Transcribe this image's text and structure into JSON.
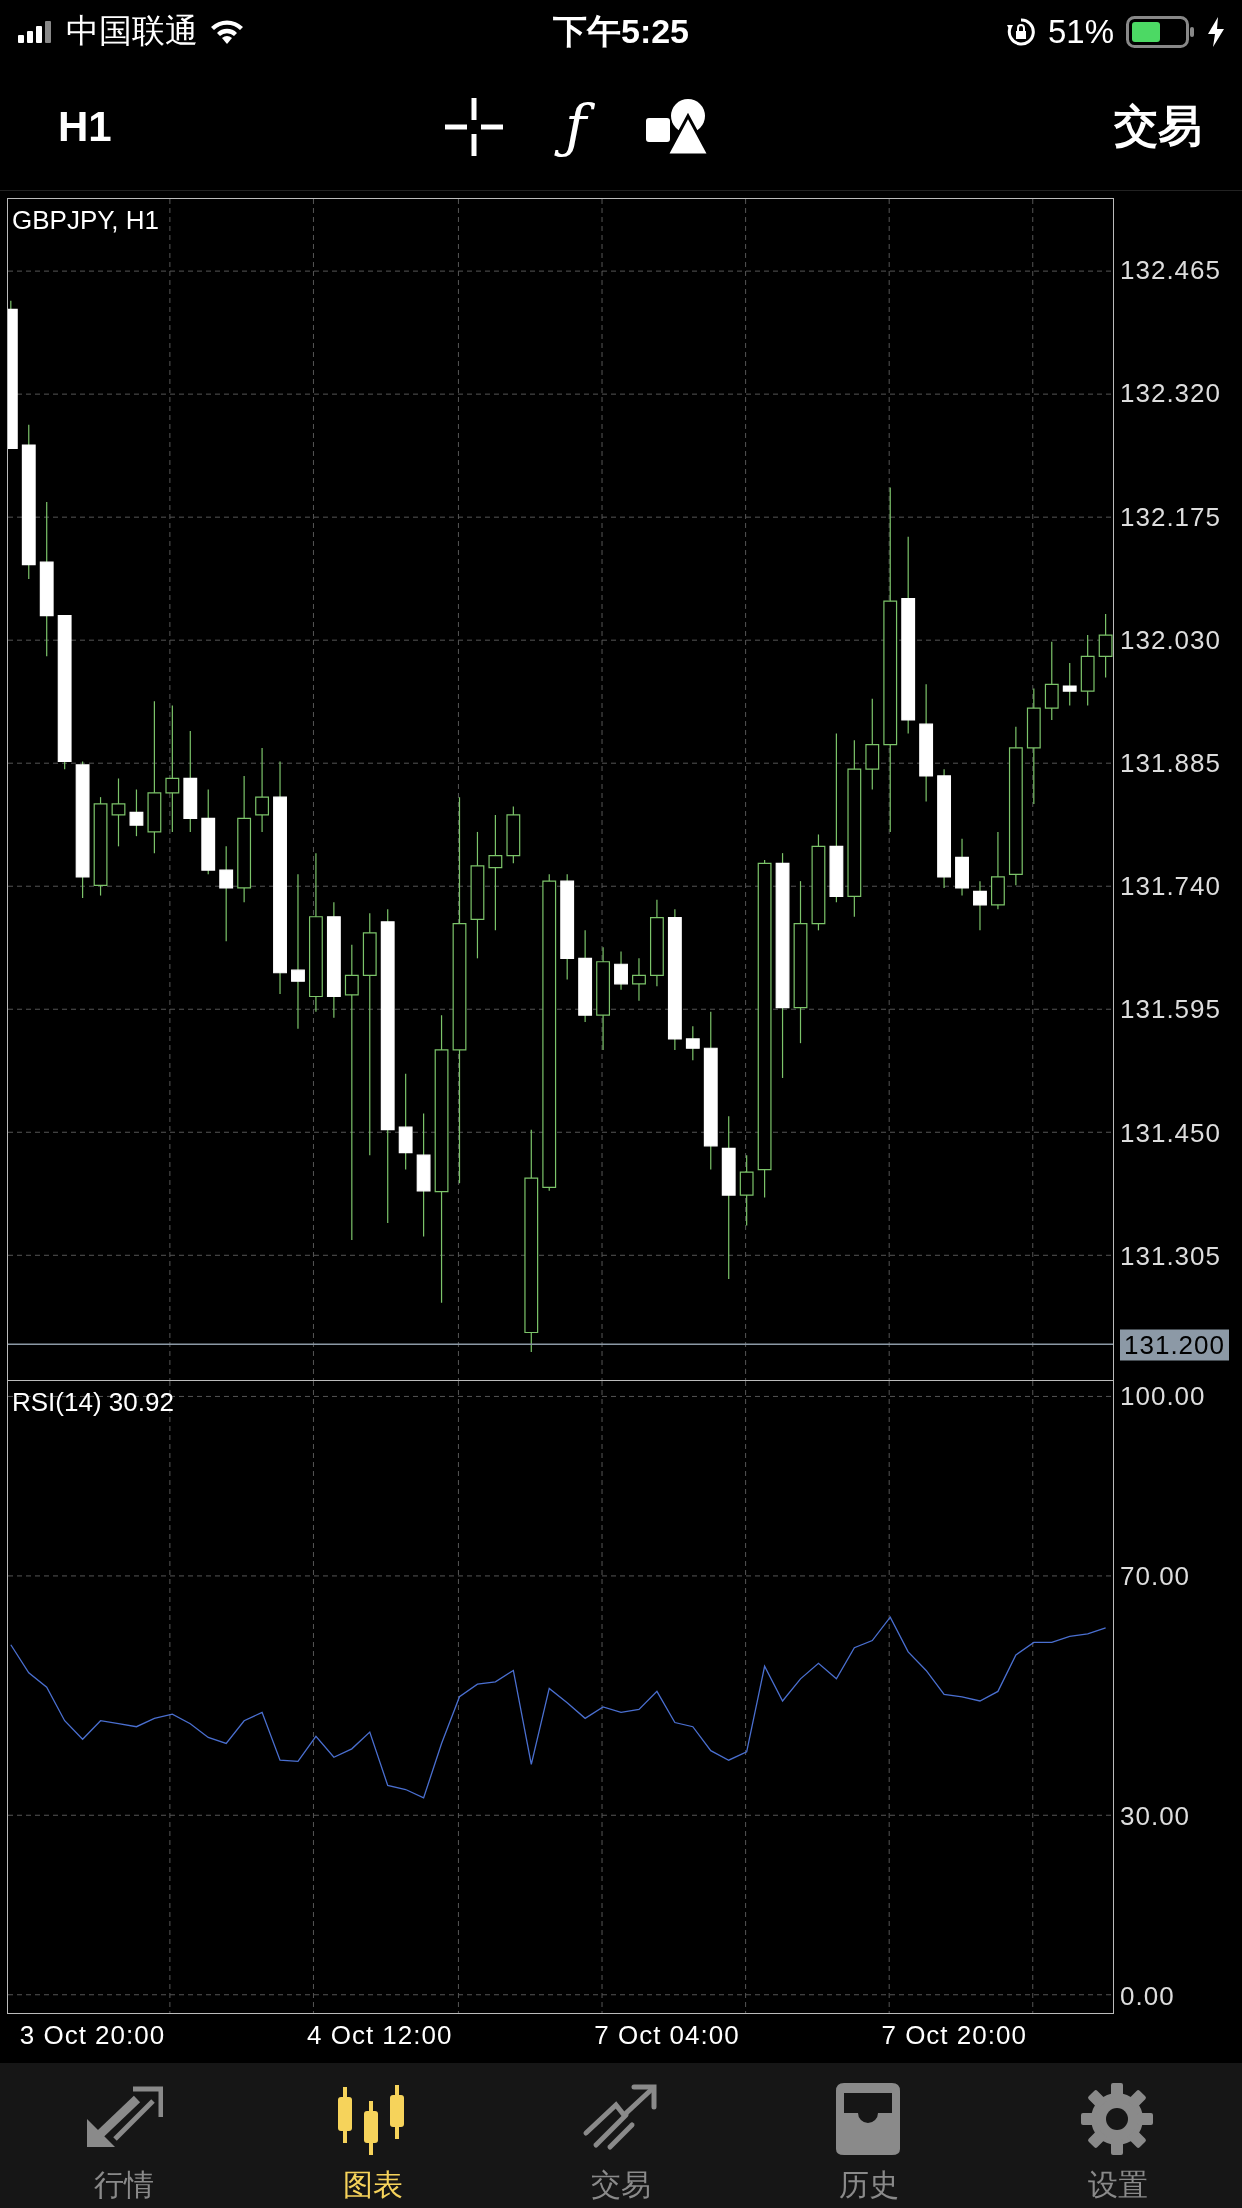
{
  "status_bar": {
    "carrier": "中国联通",
    "time": "下午5:25",
    "battery": "51%"
  },
  "toolbar": {
    "timeframe": "H1",
    "indicator_glyph": "ƒ",
    "trade": "交易"
  },
  "chart": {
    "chart_data": {
      "type": "candlestick",
      "title": "GBPJPY, H1",
      "grid": true,
      "ylim": [
        131.158,
        132.55
      ],
      "ref_lines": [
        {
          "axis": "y",
          "value": 131.2,
          "label": "131.200"
        }
      ],
      "yticks": [
        {
          "value": 132.465,
          "label": "132.465"
        },
        {
          "value": 132.32,
          "label": "132.320"
        },
        {
          "value": 132.175,
          "label": "132.175"
        },
        {
          "value": 132.03,
          "label": "132.030"
        },
        {
          "value": 131.885,
          "label": "131.885"
        },
        {
          "value": 131.74,
          "label": "131.740"
        },
        {
          "value": 131.595,
          "label": "131.595"
        },
        {
          "value": 131.45,
          "label": "131.450"
        },
        {
          "value": 131.305,
          "label": "131.305"
        }
      ],
      "ohlc": [
        [
          132.42,
          132.43,
          132.256,
          132.256
        ],
        [
          132.26,
          132.284,
          132.102,
          132.119
        ],
        [
          132.122,
          132.193,
          132.011,
          132.059
        ],
        [
          132.059,
          132.059,
          131.878,
          131.887
        ],
        [
          131.883,
          131.887,
          131.726,
          131.751
        ],
        [
          131.741,
          131.845,
          131.729,
          131.837
        ],
        [
          131.824,
          131.867,
          131.787,
          131.837
        ],
        [
          131.827,
          131.854,
          131.799,
          131.812
        ],
        [
          131.804,
          131.958,
          131.779,
          131.85
        ],
        [
          131.85,
          131.953,
          131.804,
          131.867
        ],
        [
          131.867,
          131.923,
          131.804,
          131.82
        ],
        [
          131.82,
          131.854,
          131.754,
          131.759
        ],
        [
          131.759,
          131.787,
          131.675,
          131.738
        ],
        [
          131.738,
          131.87,
          131.721,
          131.82
        ],
        [
          131.824,
          131.903,
          131.804,
          131.845
        ],
        [
          131.845,
          131.887,
          131.613,
          131.638
        ],
        [
          131.641,
          131.754,
          131.572,
          131.628
        ],
        [
          131.61,
          131.779,
          131.592,
          131.704
        ],
        [
          131.704,
          131.721,
          131.585,
          131.61
        ],
        [
          131.612,
          131.671,
          131.323,
          131.635
        ],
        [
          131.635,
          131.708,
          131.423,
          131.685
        ],
        [
          131.698,
          131.713,
          131.343,
          131.453
        ],
        [
          131.456,
          131.519,
          131.406,
          131.426
        ],
        [
          131.423,
          131.472,
          131.327,
          131.381
        ],
        [
          131.38,
          131.588,
          131.249,
          131.547
        ],
        [
          131.547,
          131.845,
          131.39,
          131.696
        ],
        [
          131.701,
          131.804,
          131.655,
          131.764
        ],
        [
          131.762,
          131.824,
          131.688,
          131.776
        ],
        [
          131.776,
          131.834,
          131.767,
          131.824
        ],
        [
          131.214,
          131.453,
          131.191,
          131.396
        ],
        [
          131.385,
          131.754,
          131.381,
          131.746
        ],
        [
          131.746,
          131.754,
          131.63,
          131.655
        ],
        [
          131.655,
          131.688,
          131.58,
          131.588
        ],
        [
          131.588,
          131.668,
          131.547,
          131.651
        ],
        [
          131.648,
          131.663,
          131.618,
          131.625
        ],
        [
          131.625,
          131.655,
          131.605,
          131.635
        ],
        [
          131.635,
          131.724,
          131.622,
          131.703
        ],
        [
          131.703,
          131.713,
          131.547,
          131.56
        ],
        [
          131.56,
          131.575,
          131.535,
          131.549
        ],
        [
          131.549,
          131.592,
          131.406,
          131.434
        ],
        [
          131.431,
          131.469,
          131.277,
          131.376
        ],
        [
          131.376,
          131.423,
          131.34,
          131.403
        ],
        [
          131.406,
          131.771,
          131.373,
          131.767
        ],
        [
          131.767,
          131.779,
          131.514,
          131.597
        ],
        [
          131.597,
          131.746,
          131.555,
          131.696
        ],
        [
          131.696,
          131.801,
          131.688,
          131.787
        ],
        [
          131.787,
          131.92,
          131.721,
          131.728
        ],
        [
          131.728,
          131.912,
          131.704,
          131.878
        ],
        [
          131.878,
          131.961,
          131.854,
          131.907
        ],
        [
          131.907,
          132.21,
          131.804,
          132.076
        ],
        [
          132.079,
          132.152,
          131.92,
          131.936
        ],
        [
          131.931,
          131.978,
          131.84,
          131.87
        ],
        [
          131.87,
          131.878,
          131.738,
          131.751
        ],
        [
          131.774,
          131.796,
          131.729,
          131.738
        ],
        [
          131.734,
          131.746,
          131.688,
          131.718
        ],
        [
          131.718,
          131.804,
          131.713,
          131.751
        ],
        [
          131.754,
          131.928,
          131.741,
          131.903
        ],
        [
          131.903,
          131.973,
          131.837,
          131.95
        ],
        [
          131.95,
          132.028,
          131.936,
          131.978
        ],
        [
          131.976,
          132.003,
          131.953,
          131.97
        ],
        [
          131.97,
          132.036,
          131.953,
          132.011
        ],
        [
          132.011,
          132.061,
          131.986,
          132.036
        ]
      ]
    }
  },
  "rsi": {
    "chart_data": {
      "type": "line",
      "title": "RSI(14) 30.92",
      "grid": true,
      "ylim": [
        -3.05,
        102.58
      ],
      "yticks": [
        {
          "value": 100,
          "label": "100.00"
        },
        {
          "value": 70,
          "label": "70.00"
        },
        {
          "value": 30,
          "label": "30.00"
        },
        {
          "value": 0,
          "label": "0.00"
        }
      ],
      "series": [
        {
          "color": "#4a6fd0",
          "values": [
            58.5,
            53.8,
            51.4,
            45.8,
            42.7,
            45.8,
            45.3,
            44.8,
            46.2,
            46.9,
            45.3,
            43.0,
            42.0,
            45.8,
            47.2,
            39.2,
            39.0,
            43.2,
            39.7,
            41.1,
            43.9,
            35.0,
            34.3,
            32.9,
            42.0,
            49.8,
            51.9,
            52.3,
            54.2,
            38.5,
            51.2,
            48.8,
            46.2,
            48.1,
            47.2,
            47.7,
            50.7,
            45.5,
            44.8,
            40.8,
            39.2,
            40.6,
            54.9,
            49.1,
            52.8,
            55.4,
            52.8,
            58.0,
            59.2,
            63.1,
            57.3,
            54.2,
            50.2,
            49.8,
            49.1,
            50.7,
            56.8,
            58.9,
            58.9,
            59.9,
            60.3,
            61.3
          ]
        }
      ]
    },
    "time_axis": [
      "3 Oct 20:00",
      "4 Oct 12:00",
      "7 Oct 04:00",
      "7 Oct 20:00"
    ]
  },
  "tabs": [
    {
      "kind": "quotes",
      "label": "行情",
      "selected": false
    },
    {
      "kind": "chart",
      "label": "图表",
      "selected": true
    },
    {
      "kind": "trade",
      "label": "交易",
      "selected": false
    },
    {
      "kind": "history",
      "label": "历史",
      "selected": false
    },
    {
      "kind": "settings",
      "label": "设置",
      "selected": false
    }
  ]
}
